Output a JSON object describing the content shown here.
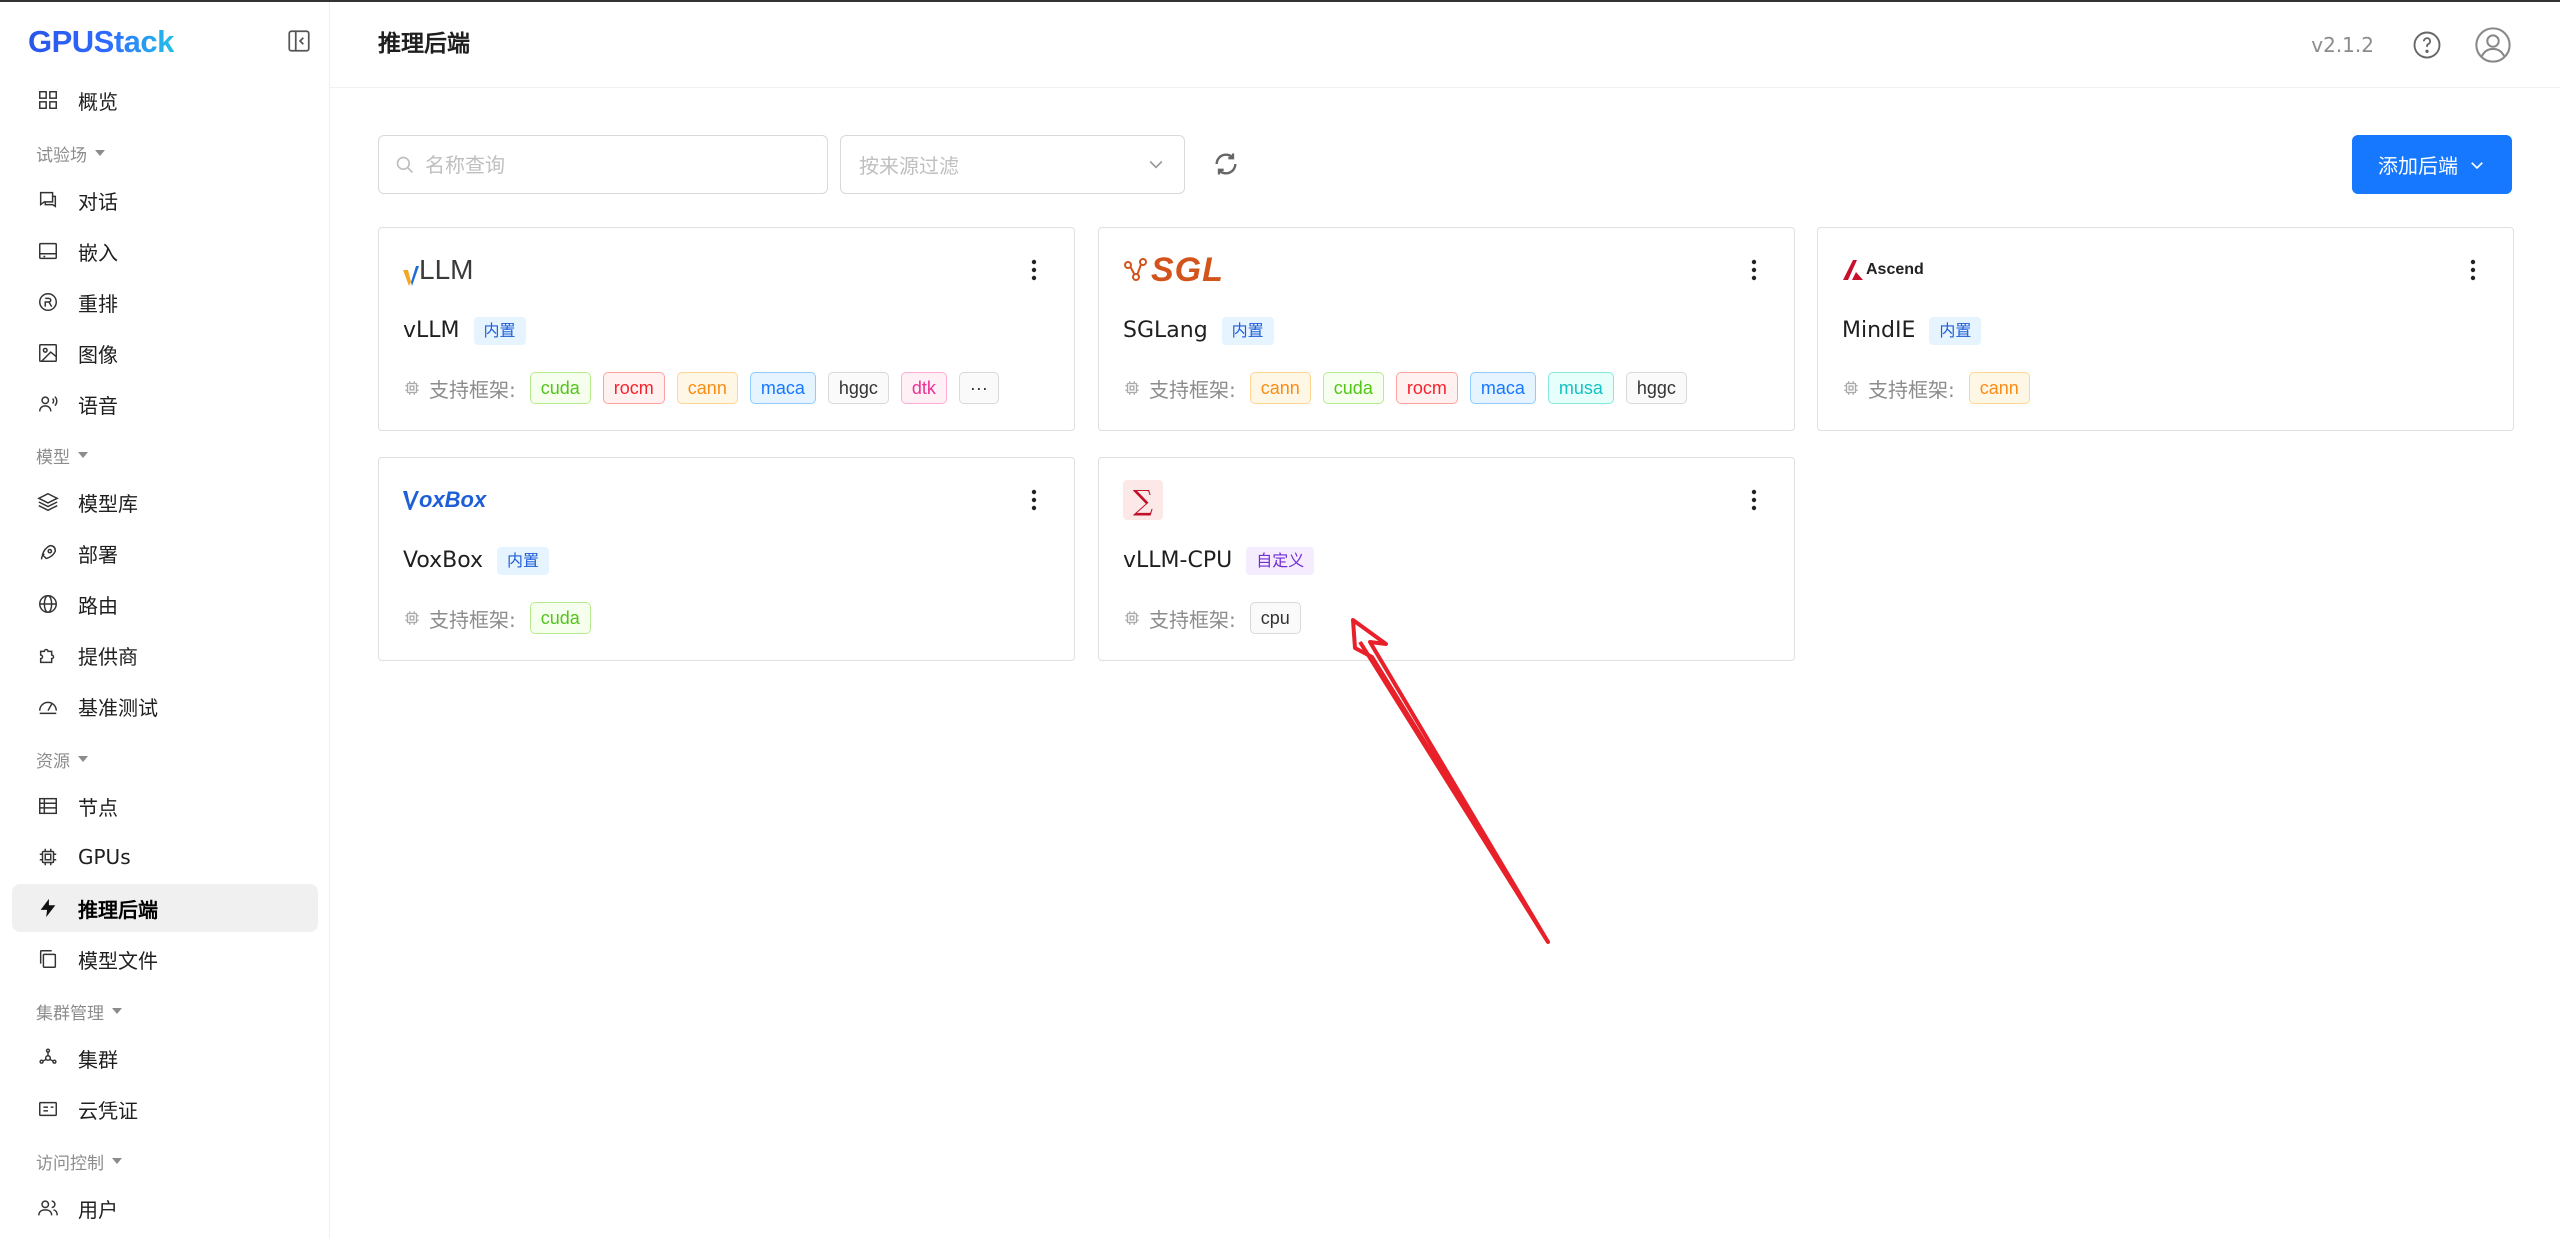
{
  "app": {
    "logo_text": "GPUStack",
    "version": "v2.1.2"
  },
  "sidebar": {
    "overview": "概览",
    "groups": {
      "playground": "试验场",
      "models": "模型",
      "resources": "资源",
      "cluster_mgmt": "集群管理",
      "access_control": "访问控制"
    },
    "items": {
      "chat": "对话",
      "embedding": "嵌入",
      "rerank": "重排",
      "image": "图像",
      "audio": "语音",
      "model_catalog": "模型库",
      "deploy": "部署",
      "routes": "路由",
      "providers": "提供商",
      "benchmark": "基准测试",
      "nodes": "节点",
      "gpus": "GPUs",
      "inference_backends": "推理后端",
      "model_files": "模型文件",
      "clusters": "集群",
      "cloud_credentials": "云凭证",
      "users": "用户"
    }
  },
  "header": {
    "title": "推理后端"
  },
  "toolbar": {
    "search_placeholder": "名称查询",
    "filter_placeholder": "按来源过滤",
    "add_button": "添加后端"
  },
  "framework_label": "支持框架:",
  "cards": [
    {
      "name": "vLLM",
      "logo_text": "LLM",
      "badge": "内置",
      "frameworks": [
        {
          "label": "cuda",
          "color": "green"
        },
        {
          "label": "rocm",
          "color": "red"
        },
        {
          "label": "cann",
          "color": "orange"
        },
        {
          "label": "maca",
          "color": "blue"
        },
        {
          "label": "hggc",
          "color": "gray"
        },
        {
          "label": "dtk",
          "color": "magenta"
        },
        {
          "label": "···",
          "color": "gray"
        }
      ]
    },
    {
      "name": "SGLang",
      "logo_text": "SGL",
      "badge": "内置",
      "frameworks": [
        {
          "label": "cann",
          "color": "orange"
        },
        {
          "label": "cuda",
          "color": "green"
        },
        {
          "label": "rocm",
          "color": "red"
        },
        {
          "label": "maca",
          "color": "blue"
        },
        {
          "label": "musa",
          "color": "cyan"
        },
        {
          "label": "hggc",
          "color": "gray"
        }
      ]
    },
    {
      "name": "MindIE",
      "logo_text": "Ascend",
      "badge": "内置",
      "frameworks": [
        {
          "label": "cann",
          "color": "orange"
        }
      ]
    },
    {
      "name": "VoxBox",
      "logo_text": "oxBox",
      "badge": "内置",
      "frameworks": [
        {
          "label": "cuda",
          "color": "green"
        }
      ]
    },
    {
      "name": "vLLM-CPU",
      "logo_text": "∑",
      "badge": "自定义",
      "frameworks": [
        {
          "label": "cpu",
          "color": "gray"
        }
      ]
    }
  ]
}
